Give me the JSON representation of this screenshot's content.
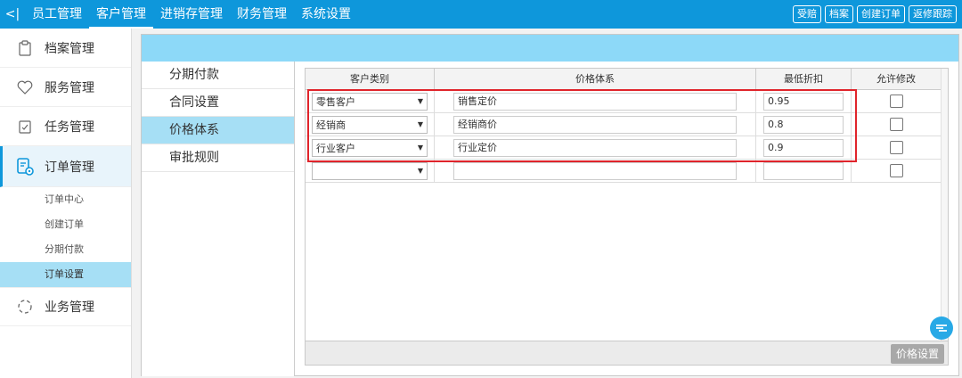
{
  "topnav": {
    "back_label": "<|",
    "items": [
      "员工管理",
      "客户管理",
      "进销存管理",
      "财务管理",
      "系统设置"
    ],
    "actions": [
      "受赔",
      "档案",
      "创建订单",
      "返修跟踪"
    ]
  },
  "sidebar": {
    "items": [
      {
        "label": "档案管理",
        "icon": "clipboard-icon"
      },
      {
        "label": "服务管理",
        "icon": "heart-icon"
      },
      {
        "label": "任务管理",
        "icon": "checklist-icon"
      },
      {
        "label": "订单管理",
        "icon": "order-settings-icon"
      },
      {
        "label": "业务管理",
        "icon": "loading-circle-icon"
      }
    ],
    "sub_items": [
      "订单中心",
      "创建订单",
      "分期付款",
      "订单设置"
    ]
  },
  "subnav": {
    "items": [
      "分期付款",
      "合同设置",
      "价格体系",
      "审批规则"
    ]
  },
  "table": {
    "headers": [
      "客户类别",
      "价格体系",
      "最低折扣",
      "允许修改"
    ],
    "rows": [
      {
        "category": "零售客户",
        "price_system": "销售定价",
        "discount": "0.95"
      },
      {
        "category": "经销商",
        "price_system": "经销商价",
        "discount": "0.8"
      },
      {
        "category": "行业客户",
        "price_system": "行业定价",
        "discount": "0.9"
      },
      {
        "category": "",
        "price_system": "",
        "discount": ""
      }
    ]
  },
  "footer": {
    "price_button": "价格设置"
  },
  "colors": {
    "topbar": "#0e97db",
    "content_bar": "#8dd9f8",
    "active_item": "#a6dff5",
    "highlight": "#e0242b"
  }
}
